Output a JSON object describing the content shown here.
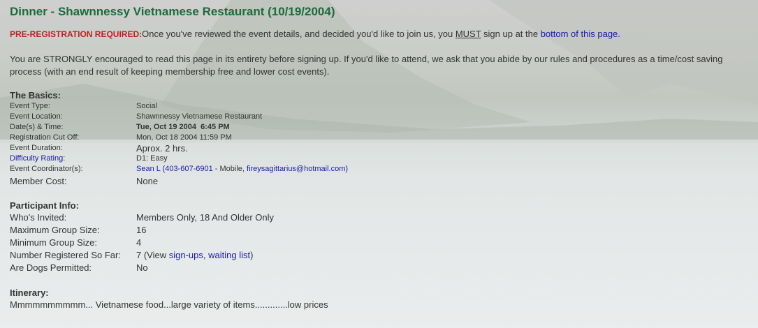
{
  "title": "Dinner - Shawnnessy Vietnamese Restaurant (10/19/2004)",
  "prereg": {
    "label": "PRE-REGISTRATION REQUIRED:",
    "text_before": "Once you've reviewed the event details, and decided you'd like to join us, you ",
    "must": "MUST",
    "text_mid": " sign up at the ",
    "link": "bottom of this page",
    "text_after": "."
  },
  "intro": "You are STRONGLY encouraged to read this page in its entirety before signing up. If you'd like to attend, we ask that you abide by our rules and procedures as a time/cost saving process (with an end result of keeping membership free and lower cost events).",
  "basics": {
    "title": "The Basics:",
    "event_type_label": "Event Type:",
    "event_type": "Social",
    "location_label": "Event Location:",
    "location": "Shawnnessy Vietnamese Restaurant",
    "datetime_label": "Date(s) & Time:",
    "datetime": "Tue, Oct 19 2004  6:45 PM",
    "cutoff_label": "Registration Cut Off:",
    "cutoff": "Mon, Oct 18 2004 11:59 PM",
    "duration_label": "Event Duration:",
    "duration": "Aprox. 2 hrs.",
    "difficulty_label": "Difficulty Rating:",
    "difficulty": "D1: Easy",
    "coordinator_label": "Event Coordinator(s):",
    "coordinator_name": "Sean L",
    "coordinator_open": " (",
    "coordinator_phone": "403-607-6901",
    "coordinator_mid": " - Mobile, ",
    "coordinator_email": "fireysagittarius@hotmail.com",
    "coordinator_close": ")",
    "cost_label": "Member Cost:",
    "cost": "None"
  },
  "participant": {
    "title": "Participant Info:",
    "invited_label": "Who's Invited:",
    "invited": "Members Only, 18 And Older Only",
    "max_label": "Maximum Group Size:",
    "max": "16",
    "min_label": "Minimum Group Size:",
    "min": "4",
    "registered_label": "Number Registered So Far:",
    "registered_prefix": "7 (View ",
    "signups_link": "sign-ups",
    "sep": ", ",
    "waiting_link": "waiting list",
    "registered_suffix": ")",
    "dogs_label": "Are Dogs Permitted:",
    "dogs": "No"
  },
  "itinerary": {
    "title": "Itinerary:",
    "text": "Mmmmmmmmmm... Vietnamese food...large variety of items.............low prices"
  },
  "colors": {
    "title": "#1c6b3a",
    "required": "#b22222",
    "link": "#1a1aa6"
  }
}
